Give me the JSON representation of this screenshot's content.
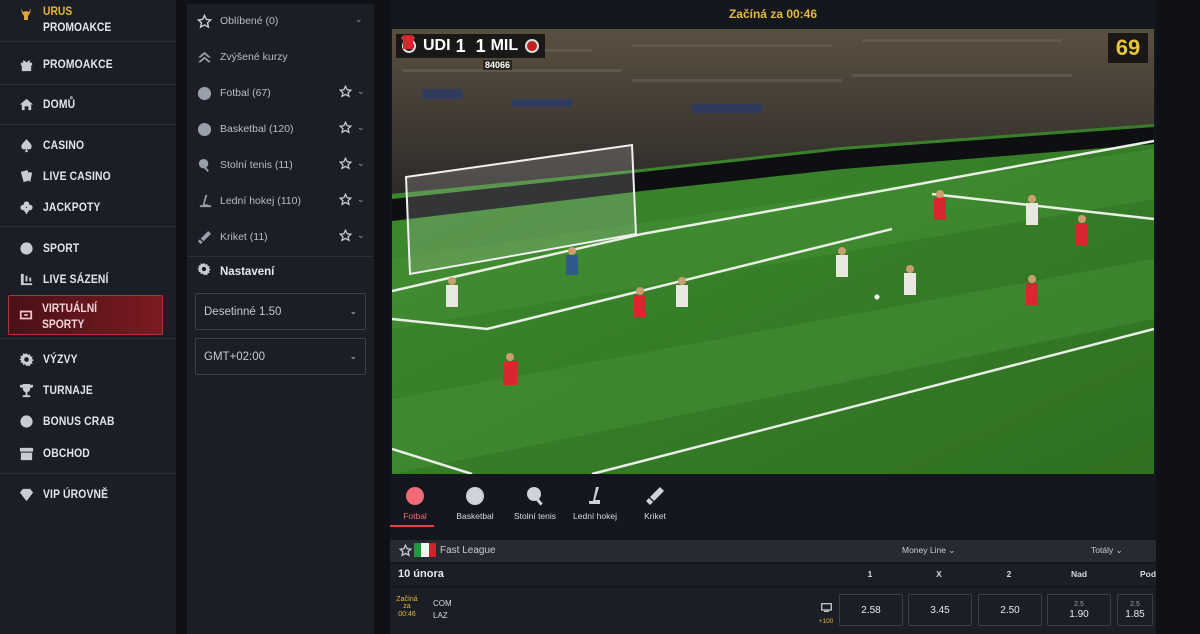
{
  "nav": {
    "top": {
      "title": "URUS",
      "subtitle": "PROMOAKCE"
    },
    "items": [
      {
        "label": "PROMOAKCE",
        "icon": "gift-icon"
      },
      {
        "label": "DOMŮ",
        "icon": "home-icon"
      },
      {
        "label": "CASINO",
        "icon": "spade-icon"
      },
      {
        "label": "LIVE CASINO",
        "icon": "cards-icon"
      },
      {
        "label": "JACKPOTY",
        "icon": "clover-icon"
      },
      {
        "label": "SPORT",
        "icon": "sport-icon"
      },
      {
        "label": "LIVE SÁZENÍ",
        "icon": "live-bet-icon"
      },
      {
        "label": "VIRTUÁLNÍ",
        "label2": "SPORTY",
        "icon": "virtual-icon"
      },
      {
        "label": "VÝZVY",
        "icon": "gear-icon"
      },
      {
        "label": "TURNAJE",
        "icon": "trophy-icon"
      },
      {
        "label": "BONUS CRAB",
        "icon": "crab-icon"
      },
      {
        "label": "OBCHOD",
        "icon": "shop-icon"
      },
      {
        "label": "VIP ÚROVNĚ",
        "icon": "diamond-icon"
      }
    ]
  },
  "sports_panel": {
    "items": [
      {
        "label": "Oblíbené (0)",
        "icon": "star-icon"
      },
      {
        "label": "Zvýšené kurzy",
        "icon": "boost-icon"
      },
      {
        "label": "Fotbal (67)",
        "icon": "football-icon"
      },
      {
        "label": "Basketbal (120)",
        "icon": "basketball-icon"
      },
      {
        "label": "Stolní tenis (11)",
        "icon": "table-tennis-icon"
      },
      {
        "label": "Lední hokej (110)",
        "icon": "hockey-icon"
      },
      {
        "label": "Kriket (11)",
        "icon": "cricket-icon"
      }
    ],
    "settings_label": "Nastavení",
    "odds_format": "Desetinné 1.50",
    "timezone": "GMT+02:00"
  },
  "main": {
    "countdown": "Začíná za 00:46",
    "video": {
      "home": "UDI",
      "home_score": "1",
      "away_score": "1",
      "away": "MIL",
      "match_id": "84066",
      "minute": "69"
    },
    "tabs": [
      {
        "label": "Fotbal",
        "icon": "football-icon"
      },
      {
        "label": "Basketbal",
        "icon": "basketball-icon"
      },
      {
        "label": "Stolní tenis",
        "icon": "table-tennis-icon"
      },
      {
        "label": "Lední hokej",
        "icon": "hockey-icon"
      },
      {
        "label": "Kriket",
        "icon": "cricket-icon"
      }
    ],
    "league": {
      "name": "Fast League",
      "moneyline": "Money Line ⌄",
      "totals": "Totály ⌄"
    },
    "date_row": {
      "date": "10 února",
      "c1": "1",
      "cx": "X",
      "c2": "2",
      "over": "Nad",
      "under": "Pod"
    },
    "event": {
      "start_a": "Začíná",
      "start_b": "za",
      "start_c": "00:46",
      "home": "COM",
      "away": "LAZ",
      "more_markets": "+100",
      "odd1": "2.58",
      "oddx": "3.45",
      "odd2": "2.50",
      "over_line": "2.5",
      "over": "1.90",
      "under_line": "2.5",
      "under": "1.85"
    }
  },
  "colors": {
    "accent": "#e6434f",
    "gold": "#e6b93a",
    "bg": "#14171d",
    "panel": "#1b1e25"
  }
}
